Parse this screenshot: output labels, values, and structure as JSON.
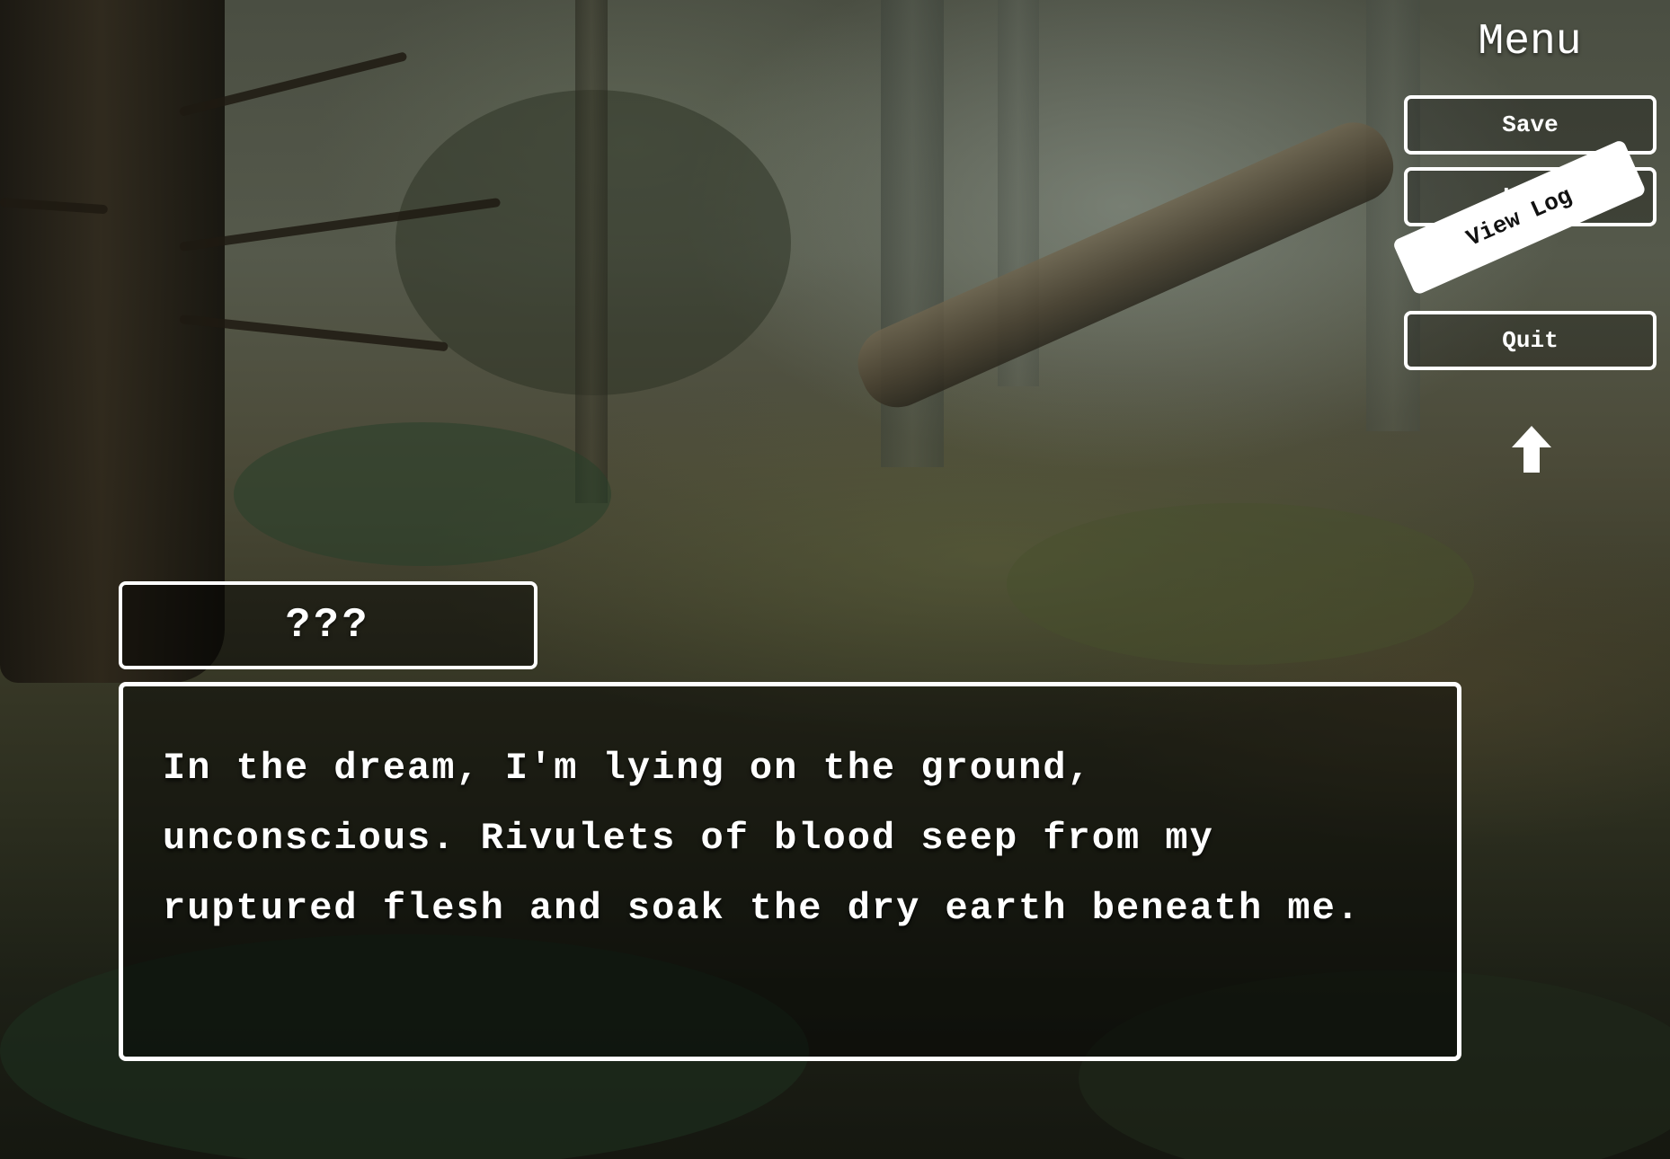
{
  "menu": {
    "title": "Menu",
    "buttons": [
      {
        "label": "Save",
        "active": false
      },
      {
        "label": "Load",
        "active": false
      },
      {
        "label": "View Log",
        "active": true
      },
      {
        "label": "Quit",
        "active": false
      }
    ],
    "toggle_icon": "arrow-up-icon"
  },
  "dialogue": {
    "speaker": "???",
    "lines": [
      "In the dream, I'm lying on the ground,",
      "unconscious. Rivulets of blood seep from my",
      "ruptured flesh and soak the dry earth beneath me."
    ]
  },
  "colors": {
    "ui_border": "#ffffff",
    "text": "#ffffff",
    "active_button_bg": "#ffffff",
    "active_button_text": "#111111"
  }
}
